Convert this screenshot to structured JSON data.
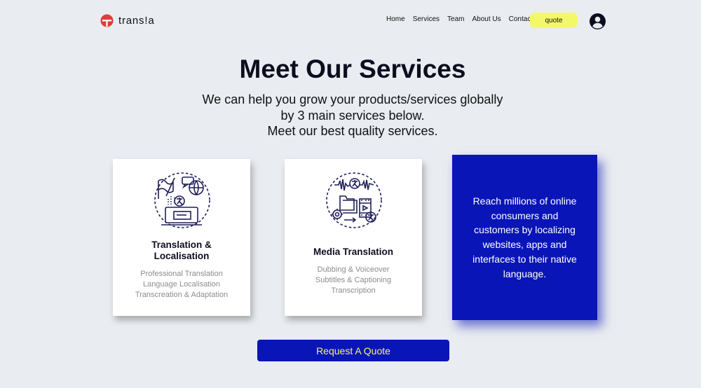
{
  "header": {
    "logo_text": "trans!a",
    "nav": [
      "Home",
      "Services",
      "Team",
      "About Us",
      "Contact"
    ],
    "quote_label": "quote"
  },
  "hero": {
    "title": "Meet Our Services",
    "subtitle": [
      "We can help you grow your products/services globally",
      "by 3 main services below.",
      "Meet our best quality services."
    ]
  },
  "cards": [
    {
      "title_lines": [
        "Translation &",
        "Localisation"
      ],
      "items": [
        "Professional Translation",
        "Language Localisation",
        "Transcreation & Adaptation"
      ]
    },
    {
      "title_lines": [
        "Media Translation"
      ],
      "items": [
        "Dubbing & Voiceover",
        "Subtitles & Captioning",
        "Transcription"
      ]
    }
  ],
  "promo": {
    "lines": [
      "Reach millions of online",
      "consumers and",
      "customers by localizing",
      "websites, apps and",
      "interfaces to their native",
      "language."
    ]
  },
  "cta_label": "Request A Quote",
  "colors": {
    "background": "#e9ecf0",
    "brand_blue": "#0a15b8",
    "accent_yellow": "#f3f86b",
    "logo_red": "#e53b3b"
  },
  "icons": {
    "logo": "translate-t-icon",
    "user": "user-account-icon",
    "card1": "translation-localisation-icon",
    "card2": "media-translation-icon"
  }
}
